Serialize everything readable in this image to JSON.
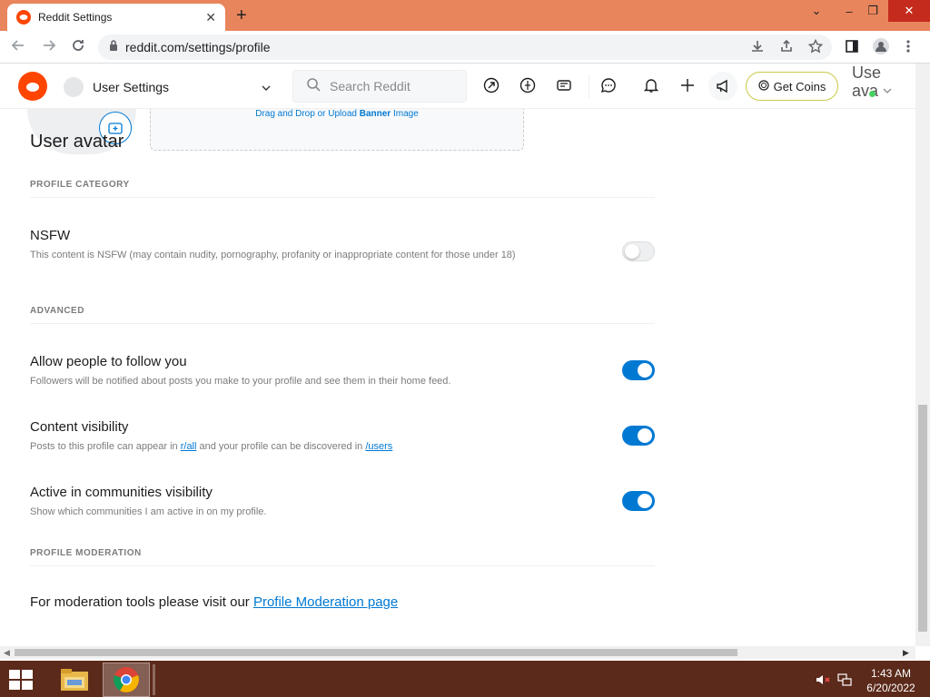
{
  "browser": {
    "tab_title": "Reddit Settings",
    "tab_close": "✕",
    "new_tab": "+",
    "url": "reddit.com/settings/profile",
    "win_minimize": "⌄",
    "win_min2": "–",
    "win_restore": "❐",
    "win_close": "✕"
  },
  "header": {
    "user_settings_label": "User Settings",
    "search_placeholder": "Search Reddit",
    "get_coins_label": "Get Coins",
    "user_label_line1": "Use",
    "user_label_line2": "ava"
  },
  "profile": {
    "banner_text_prefix": "Drag and Drop or Upload ",
    "banner_text_bold": "Banner",
    "banner_text_suffix": " Image",
    "avatar_title": "User avatar"
  },
  "sections": {
    "profile_category": "PROFILE CATEGORY",
    "advanced": "ADVANCED",
    "profile_moderation": "PROFILE MODERATION"
  },
  "settings": {
    "nsfw": {
      "title": "NSFW",
      "desc": "This content is NSFW (may contain nudity, pornography, profanity or inappropriate content for those under 18)",
      "enabled": false
    },
    "follow": {
      "title": "Allow people to follow you",
      "desc": "Followers will be notified about posts you make to your profile and see them in their home feed.",
      "enabled": true
    },
    "visibility": {
      "title": "Content visibility",
      "desc_prefix": "Posts to this profile can appear in ",
      "link1": "r/all",
      "desc_mid": " and your profile can be discovered in ",
      "link2": "/users",
      "enabled": true
    },
    "communities": {
      "title": "Active in communities visibility",
      "desc": "Show which communities I am active in on my profile.",
      "enabled": true
    }
  },
  "moderation": {
    "prefix": "For moderation tools please visit our ",
    "link": "Profile Moderation page"
  },
  "taskbar": {
    "time": "1:43 AM",
    "date": "6/20/2022"
  },
  "colors": {
    "reddit_orange": "#ff4500",
    "reddit_blue": "#0079d3",
    "tabstrip": "#e8855c",
    "taskbar": "#5b2a1a"
  }
}
